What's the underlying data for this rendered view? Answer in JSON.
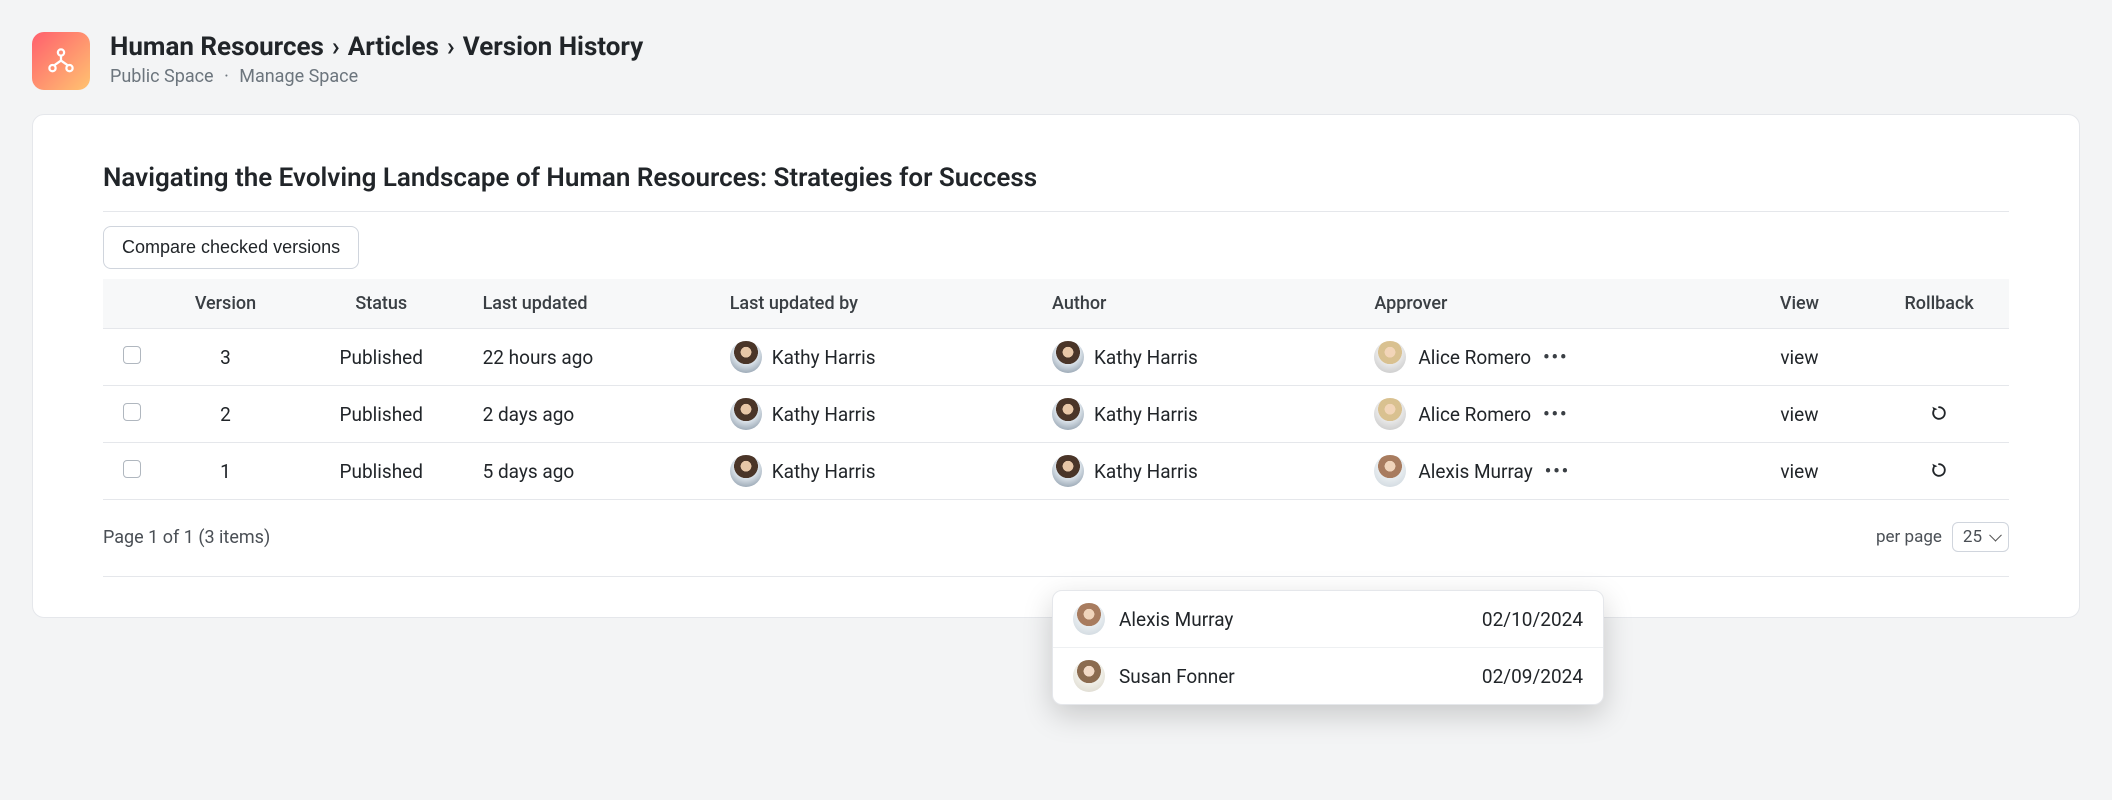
{
  "breadcrumb": {
    "space": "Human Resources",
    "section": "Articles",
    "page": "Version History"
  },
  "subheader": {
    "left": "Public Space",
    "right": "Manage Space"
  },
  "article_title": "Navigating the Evolving Landscape of Human Resources: Strategies for Success",
  "compare_label": "Compare checked versions",
  "columns": {
    "version": "Version",
    "status": "Status",
    "last_updated": "Last updated",
    "last_updated_by": "Last updated by",
    "author": "Author",
    "approver": "Approver",
    "view": "View",
    "rollback": "Rollback"
  },
  "rows": [
    {
      "version": "3",
      "status": "Published",
      "last_updated": "22 hours ago",
      "last_updated_by": "Kathy Harris",
      "author": "Kathy Harris",
      "approver": "Alice Romero",
      "view": "view",
      "rollback": false,
      "by_av": "av-kathy",
      "auth_av": "av-kathy",
      "app_av": "av-alice"
    },
    {
      "version": "2",
      "status": "Published",
      "last_updated": "2 days ago",
      "last_updated_by": "Kathy Harris",
      "author": "Kathy Harris",
      "approver": "Alice Romero",
      "view": "view",
      "rollback": true,
      "by_av": "av-kathy",
      "auth_av": "av-kathy",
      "app_av": "av-alice"
    },
    {
      "version": "1",
      "status": "Published",
      "last_updated": "5 days ago",
      "last_updated_by": "Kathy Harris",
      "author": "Kathy Harris",
      "approver": "Alexis Murray",
      "view": "view",
      "rollback": true,
      "by_av": "av-kathy",
      "auth_av": "av-kathy",
      "app_av": "av-alexis"
    }
  ],
  "more_icon": "•••",
  "pagination": {
    "info": "Page 1 of 1 (3 items)",
    "per_page_label": "per page",
    "per_page_value": "25"
  },
  "popover": [
    {
      "name": "Alexis Murray",
      "date": "02/10/2024",
      "av": "av-alexis"
    },
    {
      "name": "Susan Fonner",
      "date": "02/09/2024",
      "av": "av-susan"
    }
  ]
}
